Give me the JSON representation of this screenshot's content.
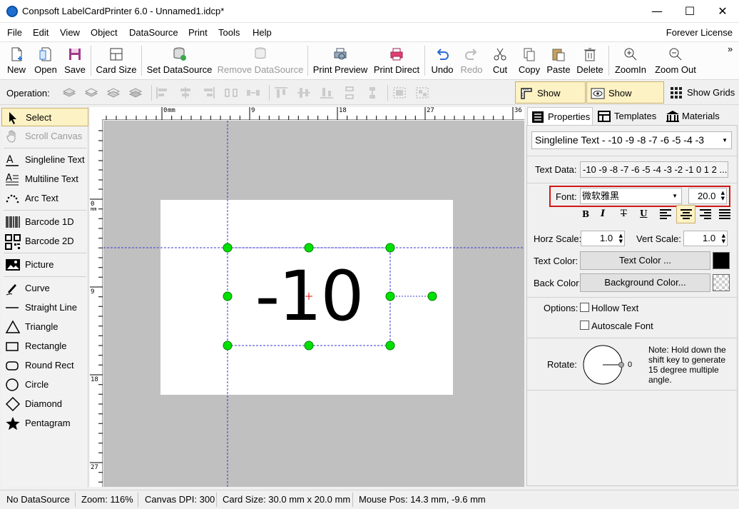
{
  "window": {
    "title": "Conpsoft LabelCardPrinter 6.0 - Unnamed1.idcp*",
    "minimize_glyph": "—",
    "maximize_glyph": "☐",
    "close_glyph": "✕"
  },
  "menu": {
    "items": [
      "File",
      "Edit",
      "View",
      "Object",
      "DataSource",
      "Print",
      "Tools",
      "Help"
    ],
    "license": "Forever License"
  },
  "toolbar": {
    "new": "New",
    "open": "Open",
    "save": "Save",
    "card_size": "Card Size",
    "set_datasource": "Set DataSource",
    "remove_datasource": "Remove DataSource",
    "print_preview": "Print Preview",
    "print_direct": "Print Direct",
    "undo": "Undo",
    "redo": "Redo",
    "cut": "Cut",
    "copy": "Copy",
    "paste": "Paste",
    "delete": "Delete",
    "zoom_in": "ZoomIn",
    "zoom_out": "Zoom Out",
    "overflow": "»"
  },
  "operation_bar": {
    "label": "Operation:",
    "show_ruler": "Show Ruler",
    "show_guides": "Show Guides",
    "show_grids": "Show Grids"
  },
  "tools": {
    "select": "Select",
    "scroll_canvas": "Scroll Canvas",
    "singleline_text": "Singleline Text",
    "multiline_text": "Multiline Text",
    "arc_text": "Arc Text",
    "barcode_1d": "Barcode 1D",
    "barcode_2d": "Barcode 2D",
    "picture": "Picture",
    "curve": "Curve",
    "straight_line": "Straight Line",
    "triangle": "Triangle",
    "rectangle": "Rectangle",
    "round_rect": "Round Rect",
    "circle": "Circle",
    "diamond": "Diamond",
    "pentagram": "Pentagram"
  },
  "ruler": {
    "top": [
      "0",
      "mm",
      "9",
      "18",
      "27",
      "36"
    ],
    "left": [
      "0",
      "mm",
      "9",
      "18",
      "27"
    ]
  },
  "canvas": {
    "label_text": "-10"
  },
  "tabs": {
    "properties": "Properties",
    "templates": "Templates",
    "materials": "Materials"
  },
  "properties": {
    "object_select": "Singleline Text - -10 -9 -8 -7 -6 -5 -4 -3",
    "text_data_label": "Text Data:",
    "text_data_value": "-10 -9 -8 -7 -6 -5 -4 -3 -2 -1 0 1 2 ...",
    "font_label": "Font:",
    "font_name": "微软雅黑",
    "font_size": "20.0",
    "bold": "B",
    "italic": "I",
    "strike": "T",
    "underline": "U",
    "horz_scale_label": "Horz Scale:",
    "horz_scale": "1.0",
    "vert_scale_label": "Vert Scale:",
    "vert_scale": "1.0",
    "text_color_label": "Text Color:",
    "text_color_button": "Text Color ...",
    "text_color": "#000000",
    "back_color_label": "Back Color:",
    "back_color_button": "Background Color...",
    "options_label": "Options:",
    "hollow_text": "Hollow Text",
    "autoscale_font": "Autoscale Font",
    "rotate_label": "Rotate:",
    "rotate_value": "0",
    "rotate_note": "Note: Hold down the shift key to generate 15 degree multiple angle."
  },
  "status": {
    "datasource": "No DataSource",
    "zoom": "Zoom: 116%",
    "dpi": "Canvas DPI: 300",
    "card_size": "Card Size: 30.0 mm x 20.0 mm",
    "mouse_pos": "Mouse Pos: 14.3 mm, -9.6 mm"
  },
  "colors": {
    "selection_handle": "#00e000",
    "guide_line": "#3a3ad0",
    "highlight": "#fdf2c4",
    "font_row_border": "#d01818"
  }
}
